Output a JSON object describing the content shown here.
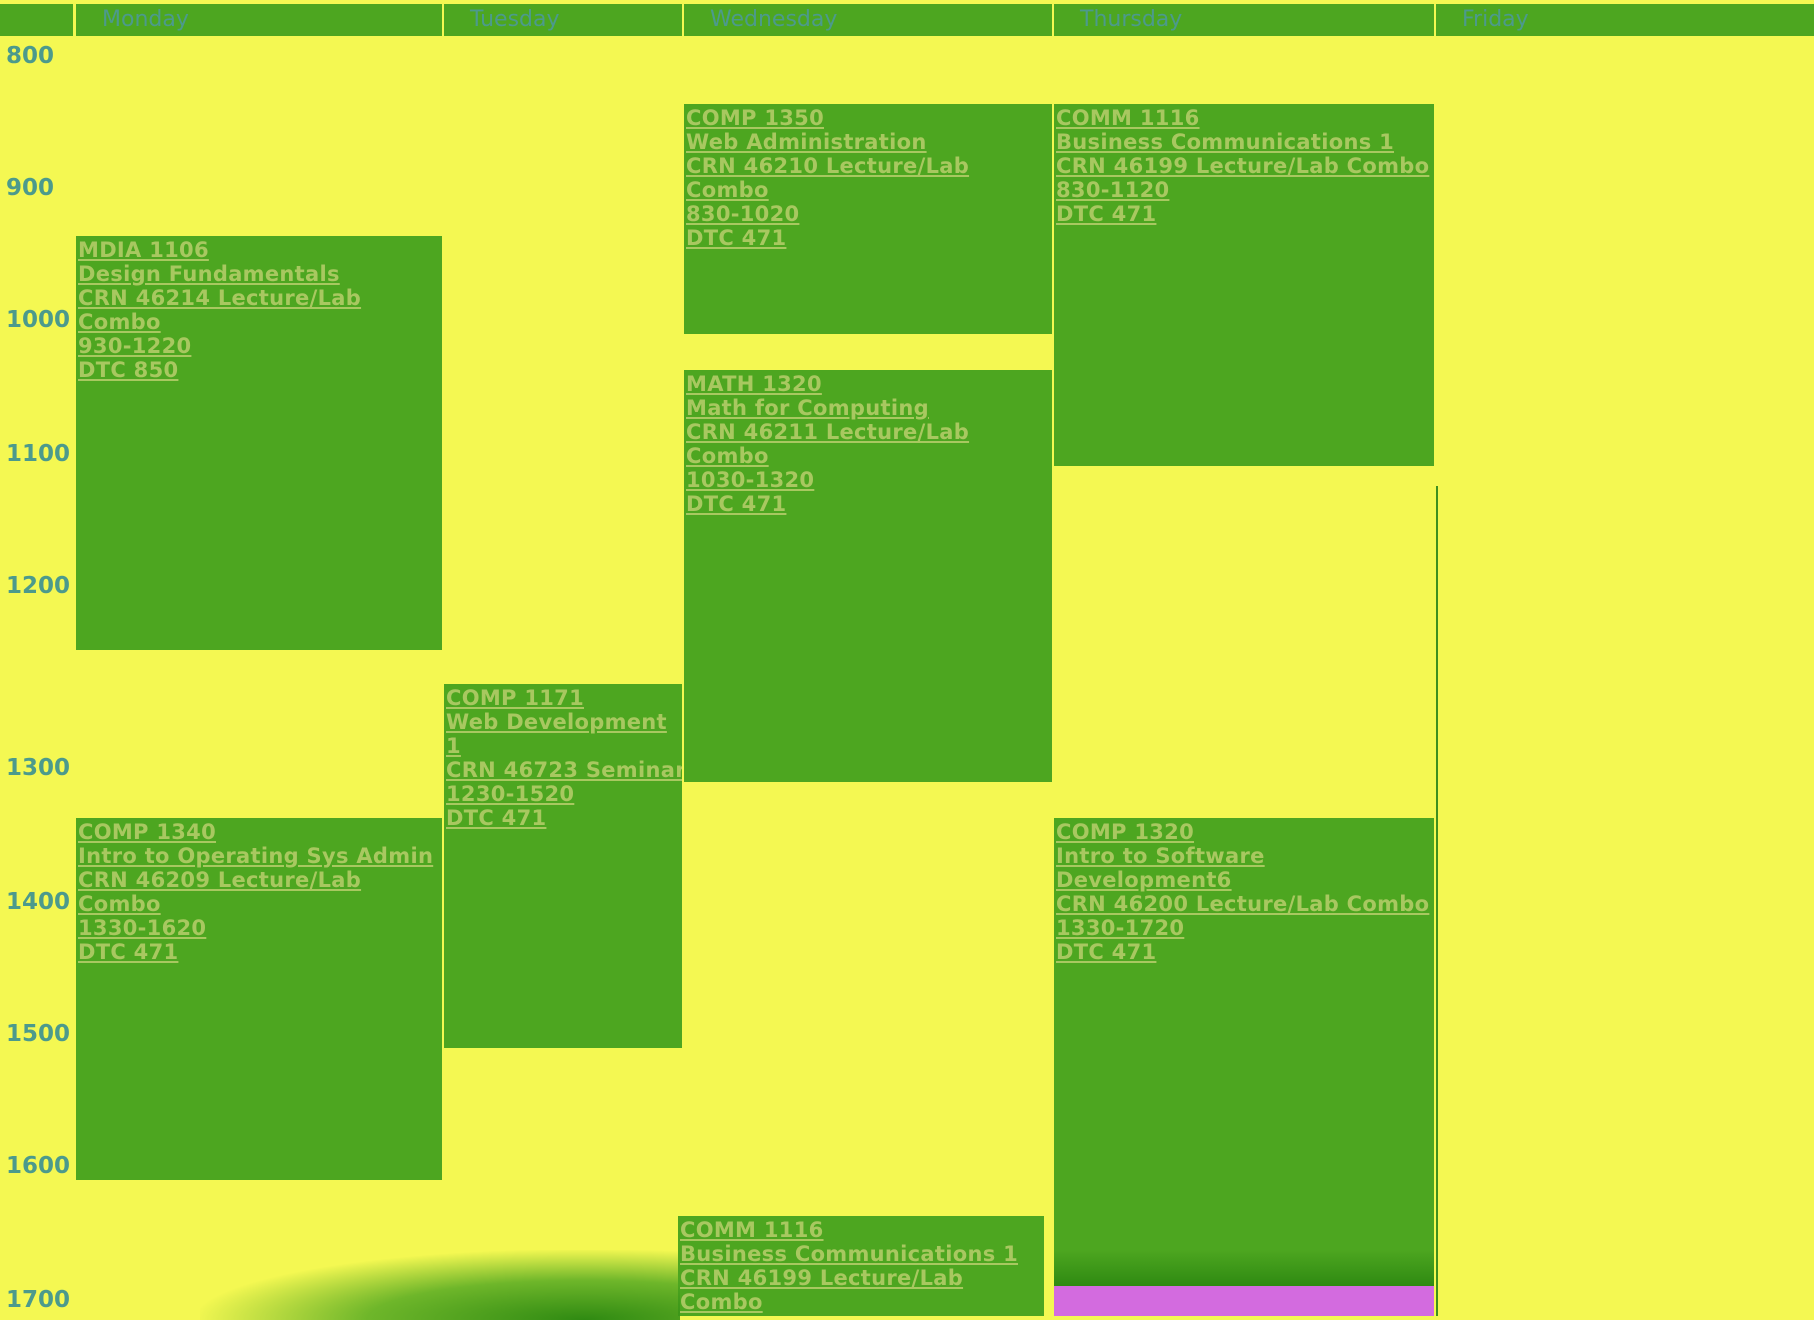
{
  "days": [
    "Monday",
    "Tuesday",
    "Wednesday",
    "Thursday",
    "Friday"
  ],
  "times": [
    "800",
    "900",
    "1000",
    "1100",
    "1200",
    "1300",
    "1400",
    "1500",
    "1600",
    "1700"
  ],
  "events": {
    "mon_mdia1106": [
      "MDIA 1106",
      "Design Fundamentals",
      "CRN 46214 Lecture/Lab",
      "Combo",
      "930-1220",
      "DTC 850"
    ],
    "mon_comp1340": [
      "COMP 1340",
      "Intro to Operating Sys Admin",
      "CRN 46209 Lecture/Lab",
      "Combo",
      "1330-1620",
      "DTC 471"
    ],
    "tue_comp1171": [
      "COMP 1171",
      "Web Development",
      "1",
      "CRN 46723 Seminar",
      "1230-1520",
      "DTC 471"
    ],
    "wed_comp1350": [
      "COMP 1350",
      "Web Administration",
      "CRN 46210 Lecture/Lab",
      "Combo",
      "830-1020",
      "DTC 471"
    ],
    "wed_math1320": [
      "MATH 1320",
      "Math for Computing",
      "CRN 46211 Lecture/Lab",
      "Combo",
      "1030-1320",
      "DTC 471"
    ],
    "wed_comm1116": [
      "COMM 1116",
      "Business Communications 1",
      "CRN 46199 Lecture/Lab",
      "Combo"
    ],
    "thu_comm1116": [
      "COMM 1116",
      "Business Communications 1",
      "CRN 46199 Lecture/Lab Combo",
      "830-1120",
      "DTC 471"
    ],
    "thu_comp1320": [
      "COMP 1320",
      "Intro to Software",
      "Development6",
      "CRN 46200 Lecture/Lab Combo",
      "1330-1720",
      "DTC 471"
    ]
  },
  "colors": {
    "background": "#f4f852",
    "event": "#4da620",
    "header": "#4da620",
    "text_link": "#a8c860",
    "time_text": "#4c9a8c",
    "accent_magenta": "#d36bdf"
  }
}
